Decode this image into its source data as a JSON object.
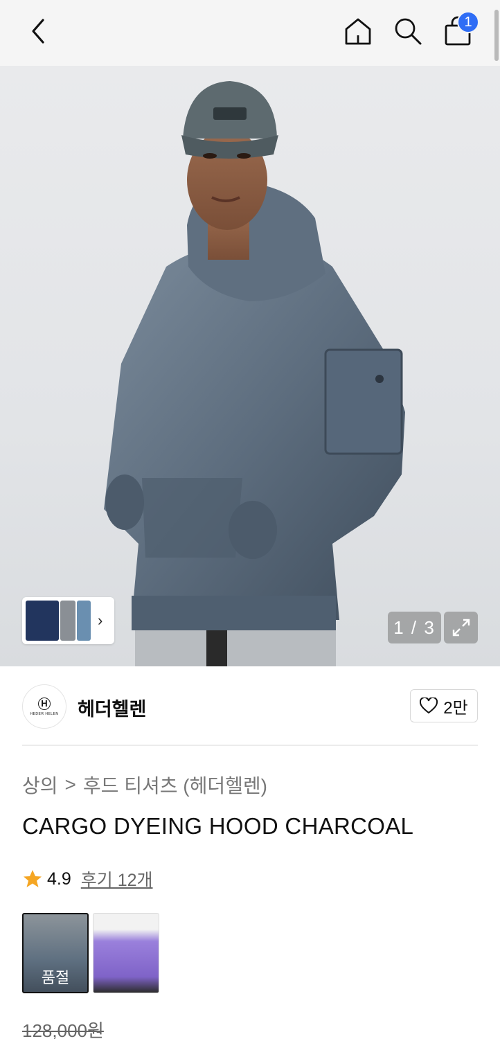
{
  "header": {
    "back_icon": "chevron-left-icon",
    "home_icon": "home-icon",
    "search_icon": "search-icon",
    "cart_icon": "shopping-bag-icon",
    "cart_count": "1",
    "accent": "#2f6df5"
  },
  "gallery": {
    "counter": "1 / 3",
    "expand_icon": "expand-icon",
    "thumbnail_next_icon": "chevron-right-icon"
  },
  "brand": {
    "name": "헤더헬렌",
    "logo_text": "HEDER HELEN",
    "likes": "2만",
    "like_icon": "heart-icon"
  },
  "product": {
    "category_1": "상의",
    "category_sep": ">",
    "category_2": "후드 티셔츠 (헤더헬렌)",
    "title": "CARGO DYEING HOOD CHARCOAL",
    "rating": "4.9",
    "reviews": "후기 12개",
    "rating_color": "#f5a623",
    "swatches": [
      {
        "label": "품절",
        "color": "#5e6f80"
      },
      {
        "label": "",
        "color": "#8a6fd1"
      }
    ],
    "original_price": "128,000원"
  }
}
